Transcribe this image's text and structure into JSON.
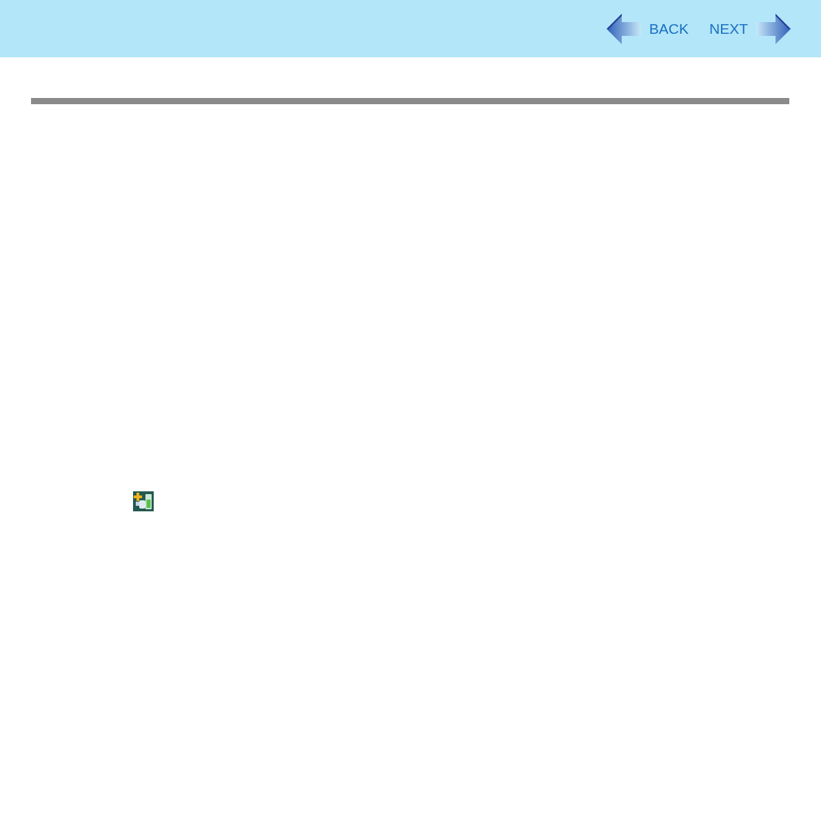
{
  "header": {
    "nav": [
      {
        "kind": "back",
        "label": "BACK"
      },
      {
        "kind": "next",
        "label": "NEXT"
      }
    ]
  }
}
